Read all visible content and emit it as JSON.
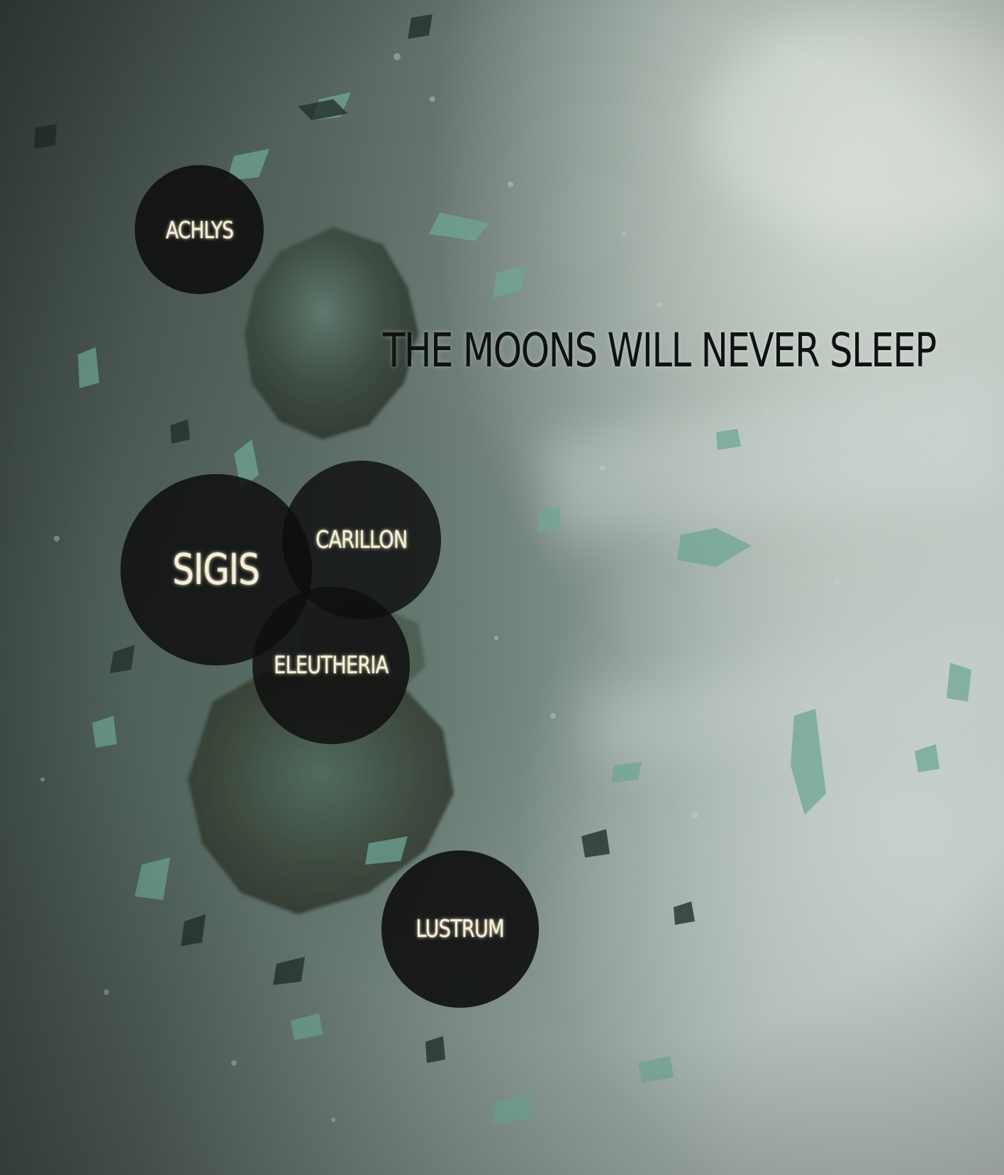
{
  "page": {
    "title": "THE MOONS WILL NEVER SLEEP"
  },
  "moons": [
    {
      "name": "ACHLYS"
    },
    {
      "name": "SIGIS"
    },
    {
      "name": "CARILLON"
    },
    {
      "name": "ELEUTHERIA"
    },
    {
      "name": "LUSTRUM"
    }
  ],
  "colors": {
    "circle_fill": "#0e0e0e",
    "label_text": "#f4f0dc",
    "headline_text": "#0e1210"
  }
}
